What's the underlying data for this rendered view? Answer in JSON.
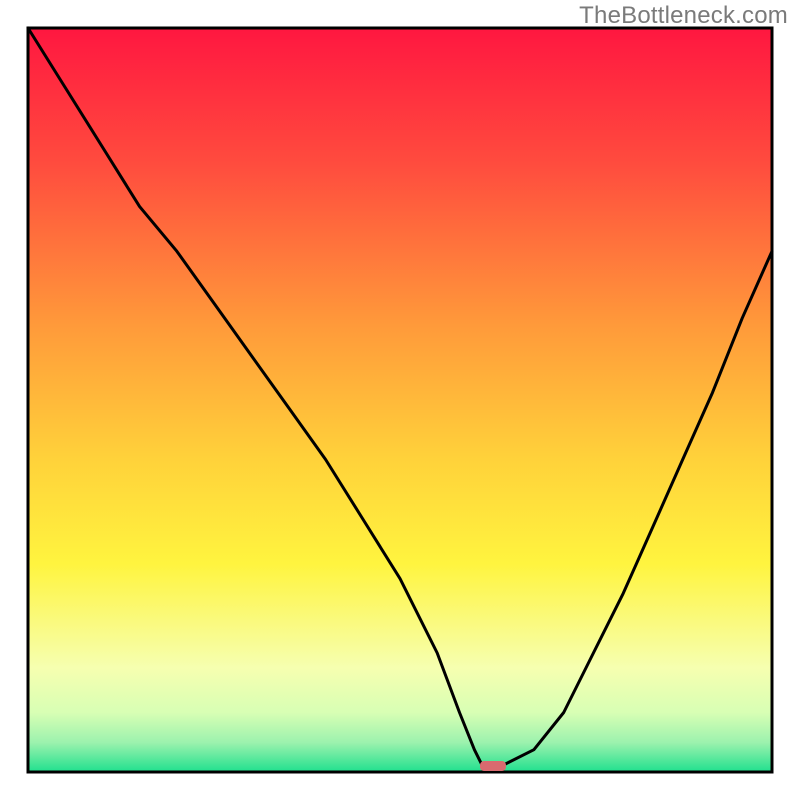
{
  "watermark": "TheBottleneck.com",
  "chart_data": {
    "type": "line",
    "title": "",
    "xlabel": "",
    "ylabel": "",
    "xlim": [
      0,
      100
    ],
    "ylim": [
      0,
      100
    ],
    "grid": false,
    "legend": false,
    "series": [
      {
        "name": "bottleneck-curve",
        "x": [
          0,
          5,
          10,
          15,
          20,
          25,
          30,
          35,
          40,
          45,
          50,
          55,
          58,
          60,
          61,
          64,
          68,
          72,
          76,
          80,
          84,
          88,
          92,
          96,
          100
        ],
        "y": [
          100,
          92,
          84,
          76,
          70,
          63,
          56,
          49,
          42,
          34,
          26,
          16,
          8,
          3,
          1,
          1,
          3,
          8,
          16,
          24,
          33,
          42,
          51,
          61,
          70
        ]
      }
    ],
    "marker": {
      "x": 62.5,
      "y": 0.8,
      "color": "#d96a6f"
    },
    "background": {
      "type": "vertical-gradient",
      "stops": [
        {
          "pos": 0.0,
          "color": "#ff1740"
        },
        {
          "pos": 0.18,
          "color": "#ff4b3e"
        },
        {
          "pos": 0.4,
          "color": "#ff9a3a"
        },
        {
          "pos": 0.58,
          "color": "#ffd23a"
        },
        {
          "pos": 0.72,
          "color": "#fff43f"
        },
        {
          "pos": 0.86,
          "color": "#f6ffb0"
        },
        {
          "pos": 0.92,
          "color": "#d8ffb4"
        },
        {
          "pos": 0.96,
          "color": "#9df2ae"
        },
        {
          "pos": 1.0,
          "color": "#20e08e"
        }
      ]
    }
  }
}
